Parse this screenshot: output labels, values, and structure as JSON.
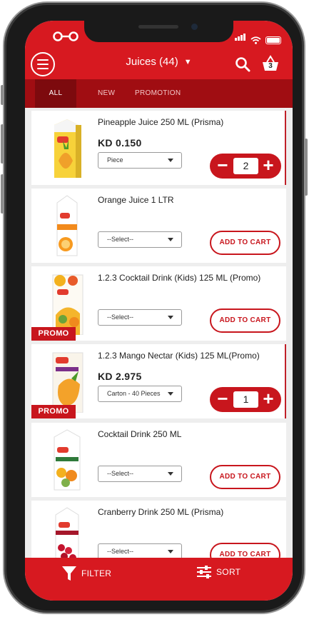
{
  "header": {
    "title": "Juices (44)",
    "cart_count": "3"
  },
  "tabs": [
    {
      "label": "ALL",
      "active": true
    },
    {
      "label": "NEW",
      "active": false
    },
    {
      "label": "PROMOTION",
      "active": false
    }
  ],
  "products": [
    {
      "name": "Pineapple Juice 250 ML (Prisma)",
      "price": "KD 0.150",
      "unit": "Piece",
      "quantity": "2",
      "promo": false,
      "thumb_icon": "pineapple-juice-carton"
    },
    {
      "name": "Orange Juice 1 LTR",
      "unit": "--Select--",
      "action": "ADD TO CART",
      "promo": false,
      "thumb_icon": "orange-juice-carton"
    },
    {
      "name": "1.2.3 Cocktail Drink (Kids) 125 ML (Promo)",
      "unit": "--Select--",
      "action": "ADD TO CART",
      "promo": true,
      "promo_label": "PROMO",
      "thumb_icon": "cocktail-drink-carton"
    },
    {
      "name": "1.2.3 Mango Nectar (Kids) 125 ML(Promo)",
      "price": "KD 2.975",
      "unit": "Carton - 40 Pieces",
      "quantity": "1",
      "promo": true,
      "promo_label": "PROMO",
      "thumb_icon": "mango-nectar-carton"
    },
    {
      "name": "Cocktail Drink 250 ML",
      "unit": "--Select--",
      "action": "ADD TO CART",
      "promo": false,
      "thumb_icon": "cocktail-drink-carton"
    },
    {
      "name": "Cranberry Drink 250 ML (Prisma)",
      "unit": "--Select--",
      "action": "ADD TO CART",
      "promo": false,
      "thumb_icon": "cranberry-drink-carton"
    }
  ],
  "bottom_bar": {
    "filter_label": "FILTER",
    "sort_label": "SORT"
  },
  "colors": {
    "brand_red": "#d71920",
    "tab_bar": "#a00d12",
    "tab_active": "#7d0a0e"
  }
}
